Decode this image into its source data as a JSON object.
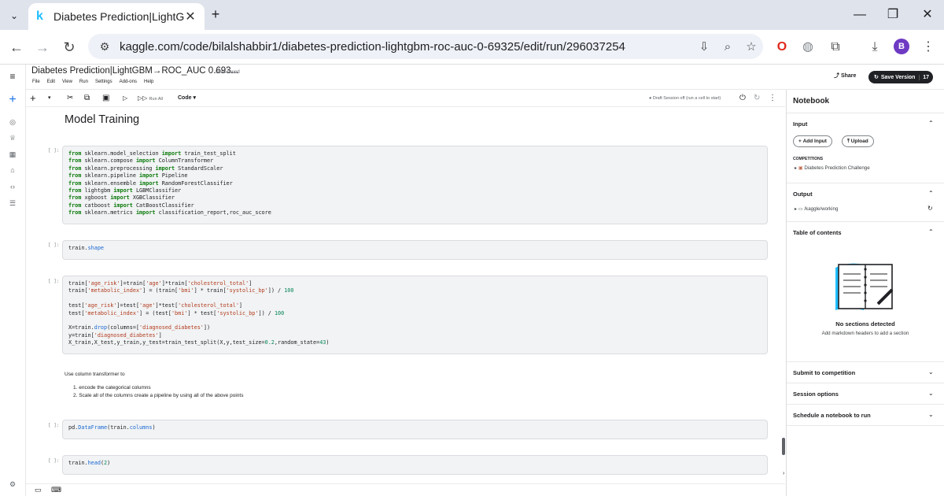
{
  "browser": {
    "tab_title": "Diabetes Prediction|LightGBM-",
    "tab_favicon": "k",
    "url": "kaggle.com/code/bilalshabbir1/diabetes-prediction-lightgbm-roc-auc-0-69325/edit/run/296037254",
    "profile_initial": "B"
  },
  "kaggle_header": {
    "notebook_title": "Diabetes Prediction|LightGBM→ROC_AUC 0.693...",
    "draft_status": "Draft saved",
    "menus": [
      "File",
      "Edit",
      "View",
      "Run",
      "Settings",
      "Add-ons",
      "Help"
    ],
    "share_label": "Share",
    "save_version_label": "Save Version",
    "version_count": "17"
  },
  "toolbar": {
    "run_all_label": "Run All",
    "cell_type": "Code",
    "session_status": "Draft Session off (run a cell to start)"
  },
  "notebook": {
    "heading": "Model Training",
    "cell_prompt": "[ ]:",
    "cell1_lines": [
      [
        [
          "kw",
          "from"
        ],
        [
          "t",
          " sklearn.model_selection "
        ],
        [
          "kw",
          "import"
        ],
        [
          "t",
          " train_test_split"
        ]
      ],
      [
        [
          "kw",
          "from"
        ],
        [
          "t",
          " sklearn.compose "
        ],
        [
          "kw",
          "import"
        ],
        [
          "t",
          " ColumnTransformer"
        ]
      ],
      [
        [
          "kw",
          "from"
        ],
        [
          "t",
          " sklearn.preprocessing "
        ],
        [
          "kw",
          "import"
        ],
        [
          "t",
          " StandardScaler"
        ]
      ],
      [
        [
          "kw",
          "from"
        ],
        [
          "t",
          " sklearn.pipeline "
        ],
        [
          "kw",
          "import"
        ],
        [
          "t",
          " Pipeline"
        ]
      ],
      [
        [
          "kw",
          "from"
        ],
        [
          "t",
          " sklearn.ensemble "
        ],
        [
          "kw",
          "import"
        ],
        [
          "t",
          " RandomForestClassifier"
        ]
      ],
      [
        [
          "kw",
          "from"
        ],
        [
          "t",
          " lightgbm "
        ],
        [
          "kw",
          "import"
        ],
        [
          "t",
          " LGBMClassifier"
        ]
      ],
      [
        [
          "kw",
          "from"
        ],
        [
          "t",
          " xgboost "
        ],
        [
          "kw",
          "import"
        ],
        [
          "t",
          " XGBClassifier"
        ]
      ],
      [
        [
          "kw",
          "from"
        ],
        [
          "t",
          " catboost "
        ],
        [
          "kw",
          "import"
        ],
        [
          "t",
          " CatBoostClassifier"
        ]
      ],
      [
        [
          "kw",
          "from"
        ],
        [
          "t",
          " sklearn.metrics "
        ],
        [
          "kw",
          "import"
        ],
        [
          "t",
          " classification_report,roc_auc_score"
        ]
      ]
    ],
    "cell2_lines": [
      [
        [
          "t",
          "train."
        ],
        [
          "at",
          "shape"
        ]
      ]
    ],
    "cell3_lines": [
      [
        [
          "t",
          "train["
        ],
        [
          "st",
          "'age_risk'"
        ],
        [
          "t",
          "]=train["
        ],
        [
          "st",
          "'age'"
        ],
        [
          "t",
          "]*train["
        ],
        [
          "st",
          "'cholesterol_total'"
        ],
        [
          "t",
          "]"
        ]
      ],
      [
        [
          "t",
          "train["
        ],
        [
          "st",
          "'metabolic_index'"
        ],
        [
          "t",
          "] = (train["
        ],
        [
          "st",
          "'bmi'"
        ],
        [
          "t",
          "] * train["
        ],
        [
          "st",
          "'systolic_bp'"
        ],
        [
          "t",
          "]) / "
        ],
        [
          "nm",
          "100"
        ]
      ],
      [
        [
          "t",
          " "
        ]
      ],
      [
        [
          "t",
          "test["
        ],
        [
          "st",
          "'age_risk'"
        ],
        [
          "t",
          "]=test["
        ],
        [
          "st",
          "'age'"
        ],
        [
          "t",
          "]*test["
        ],
        [
          "st",
          "'cholesterol_total'"
        ],
        [
          "t",
          "]"
        ]
      ],
      [
        [
          "t",
          "test["
        ],
        [
          "st",
          "'metabolic_index'"
        ],
        [
          "t",
          "] = (test["
        ],
        [
          "st",
          "'bmi'"
        ],
        [
          "t",
          "] * test["
        ],
        [
          "st",
          "'systolic_bp'"
        ],
        [
          "t",
          "]) / "
        ],
        [
          "nm",
          "100"
        ]
      ],
      [
        [
          "t",
          " "
        ]
      ],
      [
        [
          "t",
          "X=train."
        ],
        [
          "at",
          "drop"
        ],
        [
          "t",
          "(columns=["
        ],
        [
          "st",
          "'diagnosed_diabetes'"
        ],
        [
          "t",
          "])"
        ]
      ],
      [
        [
          "t",
          "y=train["
        ],
        [
          "st",
          "'diagnosed_diabetes'"
        ],
        [
          "t",
          "]"
        ]
      ],
      [
        [
          "t",
          "X_train,X_test,y_train,y_test=train_test_split(X,y,test_size="
        ],
        [
          "nm",
          "0.2"
        ],
        [
          "t",
          ",random_state="
        ],
        [
          "nm",
          "43"
        ],
        [
          "t",
          ")"
        ]
      ]
    ],
    "markdown_text": "Use column transformer to",
    "markdown_list": [
      "1. encode the categorical columns",
      "2. Scale all of the columns create a pipeline by using all of the above points"
    ],
    "cell4_lines": [
      [
        [
          "t",
          "pd."
        ],
        [
          "at",
          "DataFrame"
        ],
        [
          "t",
          "(train."
        ],
        [
          "at",
          "columns"
        ],
        [
          "t",
          ")"
        ]
      ]
    ],
    "cell5_lines": [
      [
        [
          "t",
          "train."
        ],
        [
          "at",
          "head"
        ],
        [
          "t",
          "("
        ],
        [
          "nm",
          "2"
        ],
        [
          "t",
          ")"
        ]
      ]
    ]
  },
  "right_panel": {
    "title": "Notebook",
    "input_label": "Input",
    "add_input_label": "Add Input",
    "upload_label": "Upload",
    "competitions_label": "COMPETITIONS",
    "competition_name": "Diabetes Prediction Challenge",
    "output_label": "Output",
    "output_path": "/kaggle/working",
    "toc_label": "Table of contents",
    "no_sections": "No sections detected",
    "no_sections_hint": "Add markdown headers to add a section",
    "submit_label": "Submit to competition",
    "session_options_label": "Session options",
    "schedule_label": "Schedule a notebook to run"
  },
  "colors": {
    "chrome_bg": "#dfe3ec",
    "keyword": "#0b7a0b",
    "string": "#b33b1e",
    "number": "#098658",
    "kaggle_blue": "#20beff"
  }
}
